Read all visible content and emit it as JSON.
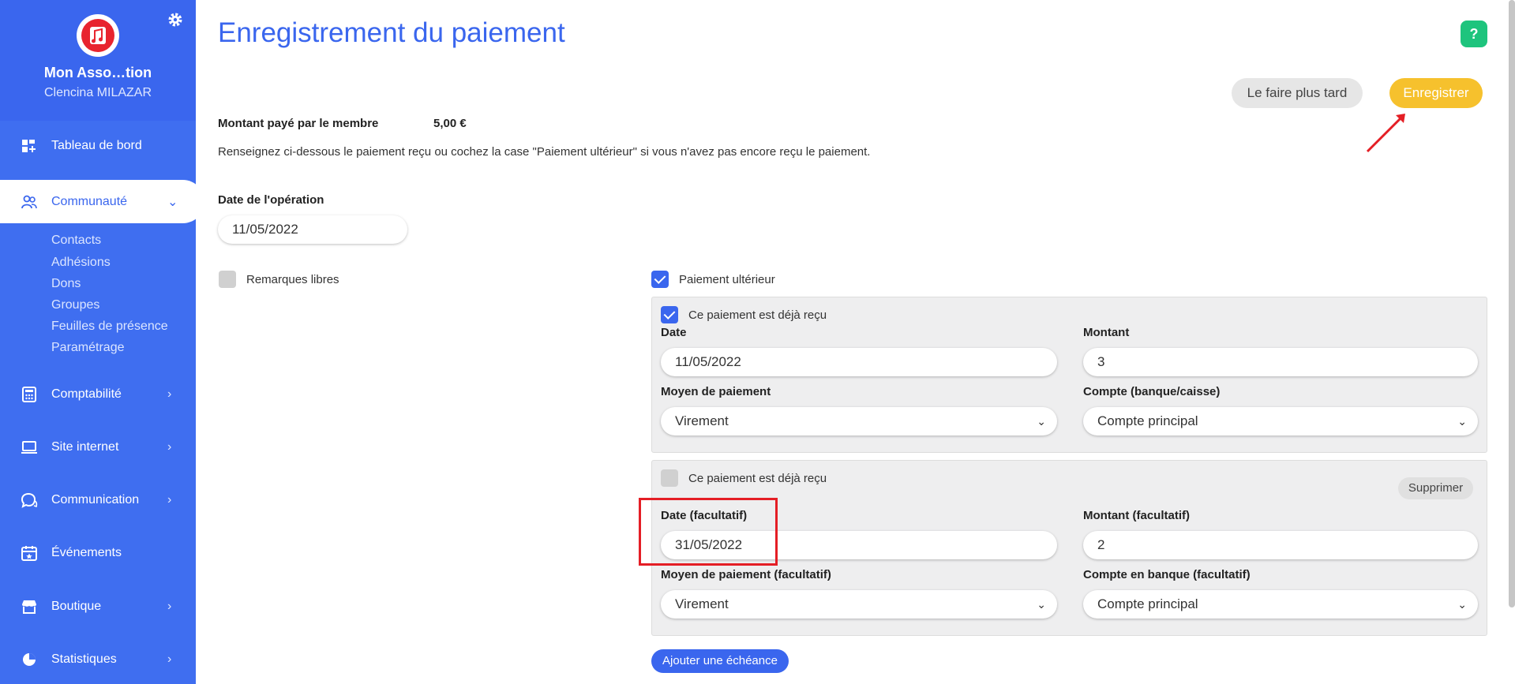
{
  "sidebar": {
    "org_name": "Mon Asso…tion",
    "user_name": "Clencina MILAZAR",
    "nav": [
      {
        "label": "Tableau de bord",
        "icon": "dashboard-icon"
      },
      {
        "label": "Communauté",
        "icon": "users-icon",
        "active": true
      },
      {
        "label": "Comptabilité",
        "icon": "calculator-icon"
      },
      {
        "label": "Site internet",
        "icon": "laptop-icon"
      },
      {
        "label": "Communication",
        "icon": "chat-icon"
      },
      {
        "label": "Événements",
        "icon": "calendar-icon"
      },
      {
        "label": "Boutique",
        "icon": "shop-icon"
      },
      {
        "label": "Statistiques",
        "icon": "pie-chart-icon"
      }
    ],
    "subitems": [
      "Contacts",
      "Adhésions",
      "Dons",
      "Groupes",
      "Feuilles de présence",
      "Paramétrage"
    ],
    "colors": {
      "background": "#3f6ef0",
      "accent": "#3a66ee"
    }
  },
  "header": {
    "title": "Enregistrement du paiement",
    "help": "?",
    "later_label": "Le faire plus tard",
    "save_label": "Enregistrer"
  },
  "summary": {
    "amount_label": "Montant payé par le membre",
    "amount_value": "5,00 €",
    "instructions": "Renseignez ci-dessous le paiement reçu ou cochez la case \"Paiement ultérieur\" si vous n'avez pas encore reçu le paiement."
  },
  "operation": {
    "date_label": "Date de l'opération",
    "date_value": "11/05/2022"
  },
  "remarks_label": "Remarques libres",
  "deferred_label": "Paiement ultérieur",
  "installments": [
    {
      "received_label": "Ce paiement est déjà reçu",
      "received": true,
      "date_label": "Date",
      "date_value": "11/05/2022",
      "amount_label": "Montant",
      "amount_value": "3",
      "method_label": "Moyen de paiement",
      "method_value": "Virement",
      "account_label": "Compte (banque/caisse)",
      "account_value": "Compte principal"
    },
    {
      "received_label": "Ce paiement est déjà reçu",
      "received": false,
      "delete_label": "Supprimer",
      "date_label": "Date (facultatif)",
      "date_value": "31/05/2022",
      "amount_label": "Montant (facultatif)",
      "amount_value": "2",
      "method_label": "Moyen de paiement (facultatif)",
      "method_value": "Virement",
      "account_label": "Compte en banque (facultatif)",
      "account_value": "Compte principal"
    }
  ],
  "add_installment_label": "Ajouter une échéance"
}
